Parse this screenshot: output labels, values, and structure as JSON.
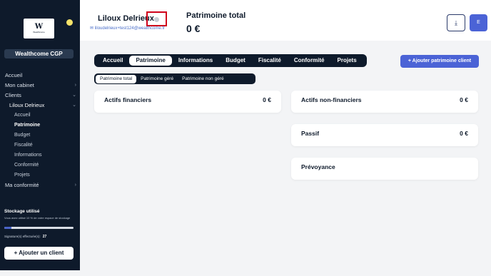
{
  "sidebar": {
    "logo_text": "W",
    "logo_sub": "Wealthcome",
    "firm_name": "Wealthcome CGP",
    "nav": [
      {
        "label": "Accueil"
      },
      {
        "label": "Mon cabinet"
      },
      {
        "label": "Clients"
      },
      {
        "label": "Liloux Delrieux"
      },
      {
        "label": "Accueil"
      },
      {
        "label": "Patrimoine"
      },
      {
        "label": "Budget"
      },
      {
        "label": "Fiscalité"
      },
      {
        "label": "Informations"
      },
      {
        "label": "Conformité"
      },
      {
        "label": "Projets"
      },
      {
        "label": "Ma conformité"
      }
    ],
    "storage_title": "Stockage utilisé",
    "storage_desc": "Vous avez utilisé 10 % de votre espace de stockage",
    "storage_used_fraction": 0.1,
    "signatures_label": "Signature(s) effectuée(s):",
    "signatures_count": "27",
    "add_client_label": "+ Ajouter un client"
  },
  "header": {
    "client_name": "Liloux Delrieux",
    "client_email": "liloudelrieux+test124@wealthcome.fr",
    "patrimoine_label": "Patrimoine total",
    "patrimoine_value": "0 €",
    "download_icon": "⤓",
    "user_initial": "E"
  },
  "tabs": [
    "Accueil",
    "Patrimoine",
    "Informations",
    "Budget",
    "Fiscalité",
    "Conformité",
    "Projets"
  ],
  "add_patrimoine_label": "+ Ajouter patrimoine client",
  "subtabs": [
    "Patrimoine total",
    "Patrimoine géré",
    "Patrimoine non géré"
  ],
  "cards": {
    "actifs_financiers": {
      "title": "Actifs financiers",
      "value": "0 €"
    },
    "actifs_non_financiers": {
      "title": "Actifs non-financiers",
      "value": "0 €"
    },
    "passif": {
      "title": "Passif",
      "value": "0 €"
    },
    "prevoyance": {
      "title": "Prévoyance"
    }
  },
  "colors": {
    "sidebar": "#0e1a2b",
    "accent": "#4b63d6",
    "highlight": "#d0021b"
  }
}
